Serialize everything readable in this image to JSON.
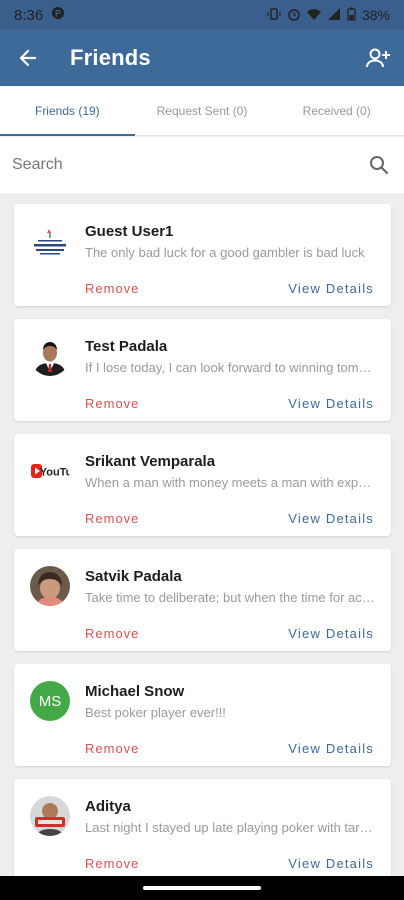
{
  "status_bar": {
    "time": "8:36",
    "battery": "38%",
    "icons": [
      "p-icon",
      "vibrate-icon",
      "alarm-icon",
      "wifi-icon",
      "signal-icon",
      "battery-icon"
    ]
  },
  "header": {
    "title": "Friends",
    "back_icon": "arrow-left-icon",
    "add_icon": "add-person-icon",
    "color": "#3d6a99"
  },
  "tabs": [
    {
      "label": "Friends (19)",
      "active": true
    },
    {
      "label": "Request Sent (0)",
      "active": false
    },
    {
      "label": "Received (0)",
      "active": false
    }
  ],
  "search": {
    "placeholder": "Search",
    "value": ""
  },
  "friends": [
    {
      "name": "Guest User1",
      "status": "The only bad luck for a good gambler is bad luck"
    },
    {
      "name": "Test Padala",
      "status": "If I lose today, I can look forward to winning tomorrow"
    },
    {
      "name": "Srikant Vemparala",
      "status": "When a man with money meets a man with experience"
    },
    {
      "name": "Satvik Padala",
      "status": "Take time to deliberate; but when the time for action"
    },
    {
      "name": "Michael Snow",
      "status": "Best poker player ever!!!",
      "initials": "MS"
    },
    {
      "name": "Aditya",
      "status": "Last night I stayed up late playing poker with tarot cards"
    }
  ],
  "actions": {
    "remove": "Remove",
    "details": "View Details"
  },
  "colors": {
    "remove": "#d9534f",
    "accent": "#3d6a99",
    "initials_bg": "#43a847"
  }
}
